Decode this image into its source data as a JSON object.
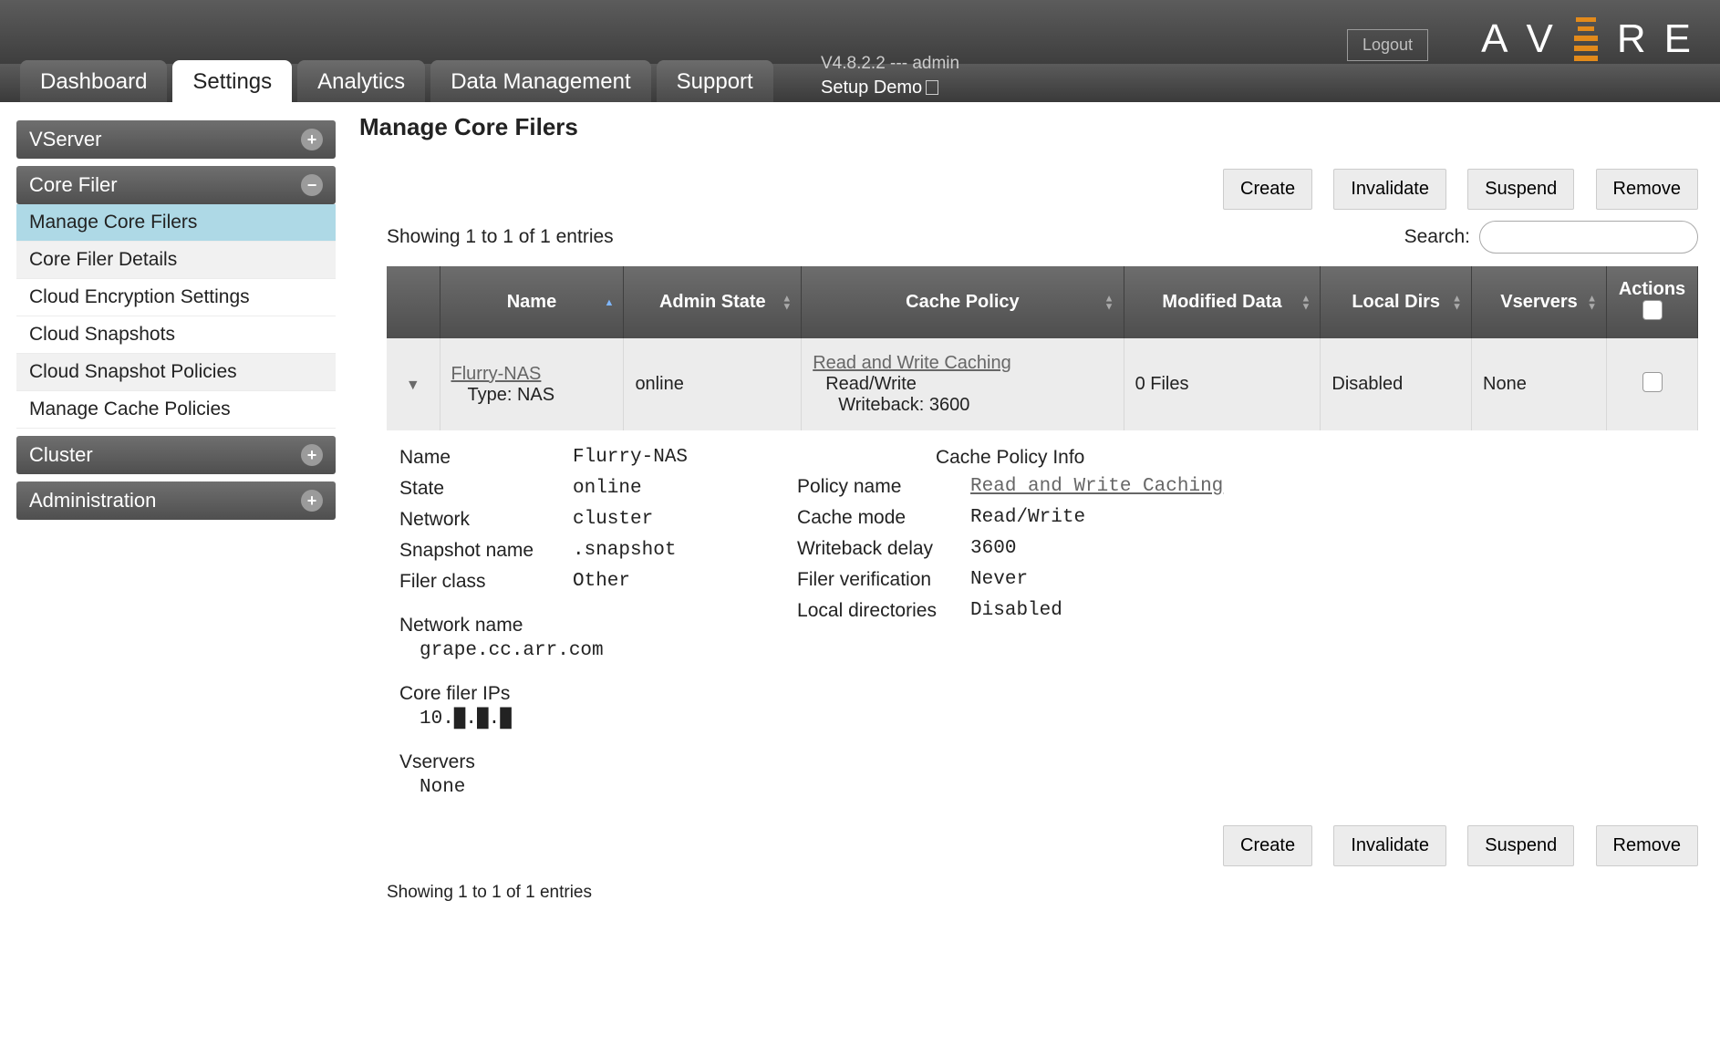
{
  "header": {
    "logout": "Logout",
    "version_line": "V4.8.2.2 --- admin",
    "demo_line": "Setup Demo",
    "logo_letters": [
      "A",
      "V",
      "R",
      "E"
    ]
  },
  "tabs": {
    "dashboard": "Dashboard",
    "settings": "Settings",
    "analytics": "Analytics",
    "data_mgmt": "Data Management",
    "support": "Support"
  },
  "sidebar": {
    "vserver": "VServer",
    "core_filer": "Core Filer",
    "items": [
      "Manage Core Filers",
      "Core Filer Details",
      "Cloud Encryption Settings",
      "Cloud Snapshots",
      "Cloud Snapshot Policies",
      "Manage Cache Policies"
    ],
    "cluster": "Cluster",
    "administration": "Administration"
  },
  "page": {
    "title": "Manage Core Filers",
    "showing": "Showing 1 to 1 of 1 entries",
    "search_label": "Search:"
  },
  "buttons": {
    "create": "Create",
    "invalidate": "Invalidate",
    "suspend": "Suspend",
    "remove": "Remove"
  },
  "table": {
    "headers": {
      "name": "Name",
      "admin_state": "Admin State",
      "cache_policy": "Cache Policy",
      "modified_data": "Modified Data",
      "local_dirs": "Local Dirs",
      "vservers": "Vservers",
      "actions": "Actions"
    },
    "row": {
      "name_link": "Flurry-NAS",
      "type_line": "Type: NAS",
      "admin_state": "online",
      "cache_policy_link": "Read and Write Caching",
      "cache_mode_line": "Read/Write",
      "writeback_line": "Writeback: 3600",
      "modified_data": "0 Files",
      "local_dirs": "Disabled",
      "vservers": "None"
    }
  },
  "detail": {
    "left": {
      "name_lbl": "Name",
      "name_val": "Flurry-NAS",
      "state_lbl": "State",
      "state_val": "online",
      "network_lbl": "Network",
      "network_val": "cluster",
      "snapshot_lbl": "Snapshot name",
      "snapshot_val": ".snapshot",
      "filer_class_lbl": "Filer class",
      "filer_class_val": "Other",
      "network_name_lbl": "Network name",
      "network_name_val": "grape.cc.arr.com",
      "ips_lbl": "Core filer IPs",
      "ips_val": "10.█.█.█",
      "vservers_lbl": "Vservers",
      "vservers_val": "None"
    },
    "right": {
      "title": "Cache Policy Info",
      "policy_name_lbl": "Policy name",
      "policy_name_val": "Read and Write Caching",
      "cache_mode_lbl": "Cache mode",
      "cache_mode_val": "Read/Write",
      "writeback_lbl": "Writeback delay",
      "writeback_val": "3600",
      "filer_ver_lbl": "Filer verification",
      "filer_ver_val": "Never",
      "local_dirs_lbl": "Local directories",
      "local_dirs_val": "Disabled"
    }
  }
}
